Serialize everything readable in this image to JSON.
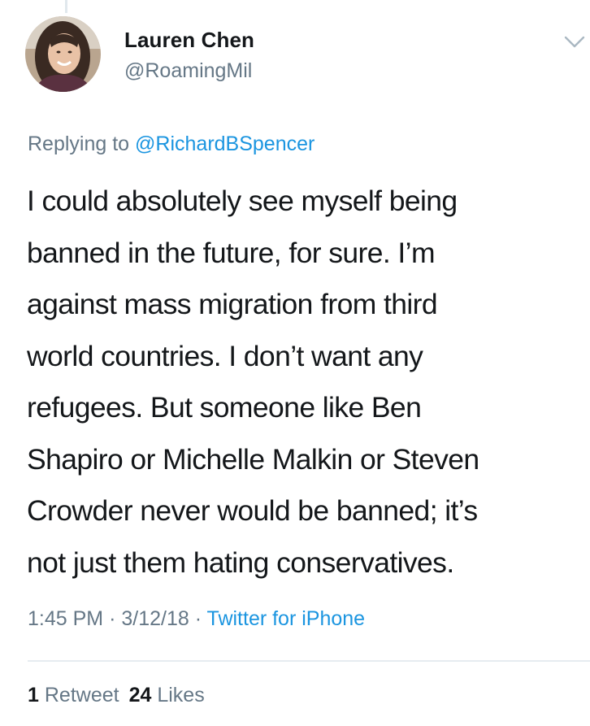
{
  "tweet": {
    "author_name": "Lauren Chen",
    "author_handle": "@RoamingMil",
    "replying_prefix": "Replying to",
    "replying_to": "@RichardBSpencer",
    "text_lines": [
      "I could absolutely see myself being",
      "banned in the future, for sure. I’m",
      "against mass migration from third",
      "world countries. I don’t want any",
      "refugees. But someone like Ben",
      "Shapiro or Michelle Malkin or Steven",
      "Crowder never would be banned; it’s",
      "not just them hating conservatives."
    ],
    "time": "1:45 PM",
    "date": "3/12/18",
    "separator": "·",
    "source": "Twitter for iPhone",
    "retweet_count": "1",
    "retweet_label": "Retweet",
    "like_count": "24",
    "like_label": "Likes"
  },
  "icons": {
    "menu": "chevron-down-icon",
    "avatar": "profile-photo"
  },
  "colors": {
    "text": "#14171a",
    "secondary": "#657786",
    "link": "#1b95e0",
    "divider": "#e6ecf0"
  }
}
